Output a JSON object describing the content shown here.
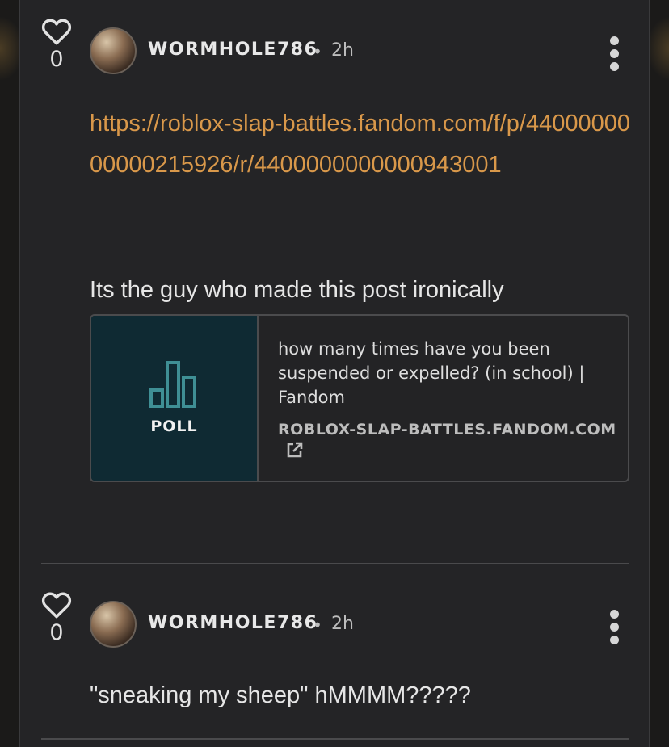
{
  "replies": [
    {
      "likes": "0",
      "author": "WORMHOLE786",
      "separator": "•",
      "time": "2h",
      "link": "https://roblox-slap-battles.fandom.com/f/p/4400000000000215926/r/4400000000000943001",
      "text": "Its the guy who made this post ironically",
      "embed": {
        "badge": "POLL",
        "title": "how many times have you been suspended or expelled? (in school) | Fandom",
        "domain": "ROBLOX-SLAP-BATTLES.FANDOM.COM"
      }
    },
    {
      "likes": "0",
      "author": "WORMHOLE786",
      "separator": "•",
      "time": "2h",
      "text": "\"sneaking my sheep\" hMMMM?????"
    }
  ],
  "icons": [
    "heart-icon",
    "kebab-menu-icon",
    "poll-chart-icon",
    "external-link-icon"
  ],
  "colors": {
    "link": "#d9984a",
    "panel": "#242426",
    "poll_bg": "#0f2a33",
    "poll_icon": "#3f8f95"
  }
}
